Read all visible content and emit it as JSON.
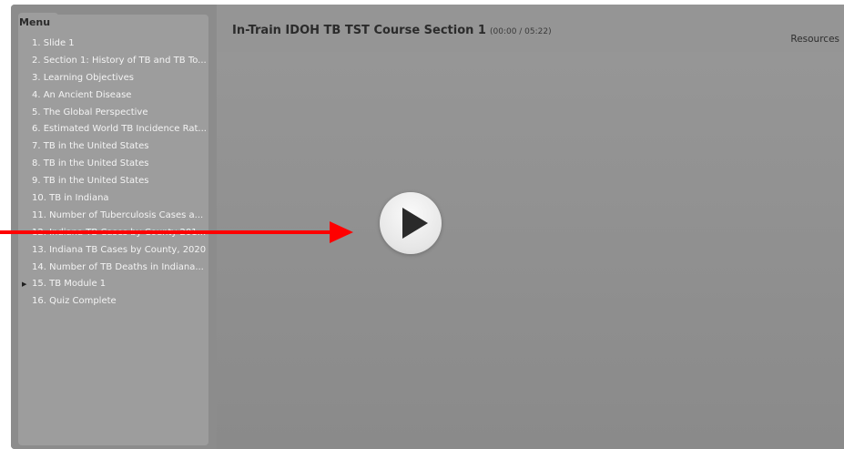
{
  "menu": {
    "title": "Menu",
    "items": [
      {
        "label": "1. Slide 1",
        "expandable": false
      },
      {
        "label": "2. Section 1: History of TB and TB To...",
        "expandable": false
      },
      {
        "label": "3. Learning Objectives",
        "expandable": false
      },
      {
        "label": "4. An Ancient Disease",
        "expandable": false
      },
      {
        "label": "5. The Global Perspective",
        "expandable": false
      },
      {
        "label": "6. Estimated World TB Incidence Rat...",
        "expandable": false
      },
      {
        "label": "7. TB in the United States",
        "expandable": false
      },
      {
        "label": "8. TB in the United States",
        "expandable": false
      },
      {
        "label": "9. TB in the United States",
        "expandable": false
      },
      {
        "label": "10. TB in Indiana",
        "expandable": false
      },
      {
        "label": "11. Number of Tuberculosis Cases a...",
        "expandable": false
      },
      {
        "label": "12. Indiana TB Cases by County 201...",
        "expandable": false
      },
      {
        "label": "13. Indiana TB Cases by County, 2020",
        "expandable": false
      },
      {
        "label": "14. Number of TB Deaths in Indiana...",
        "expandable": false
      },
      {
        "label": "15. TB Module 1",
        "expandable": true
      },
      {
        "label": "16. Quiz Complete",
        "expandable": false
      }
    ]
  },
  "header": {
    "course_title": "In-Train IDOH TB TST Course Section 1",
    "time": "(00:00 / 05:22)",
    "resources_label": "Resources"
  },
  "player": {
    "play_icon": "play-icon"
  },
  "annotation": {
    "arrow_color": "#ff0000"
  }
}
